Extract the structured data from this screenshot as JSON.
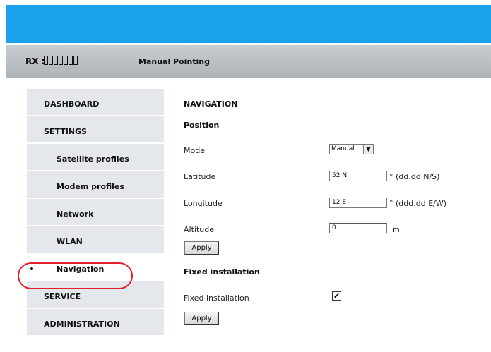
{
  "header": {
    "rx_label": "RX :",
    "page_mode": "Manual Pointing",
    "brand_color": "#1aa2ec"
  },
  "sidebar": {
    "items": [
      {
        "label": "DASHBOARD",
        "level": "top"
      },
      {
        "label": "SETTINGS",
        "level": "top"
      },
      {
        "label": "Satellite profiles",
        "level": "sub"
      },
      {
        "label": "Modem profiles",
        "level": "sub"
      },
      {
        "label": "Network",
        "level": "sub"
      },
      {
        "label": "WLAN",
        "level": "sub"
      },
      {
        "label": "Navigation",
        "level": "sub",
        "active": true
      },
      {
        "label": "SERVICE",
        "level": "top"
      },
      {
        "label": "ADMINISTRATION",
        "level": "top"
      }
    ],
    "highlight_color": "#e0202a"
  },
  "main": {
    "title": "NAVIGATION",
    "position_heading": "Position",
    "mode": {
      "label": "Mode",
      "value": "Manual",
      "arrow_icon": "chevron-down-icon"
    },
    "latitude": {
      "label": "Latitude",
      "value": "52 N",
      "unit": "° (dd.dd N/S)"
    },
    "longitude": {
      "label": "Longitude",
      "value": "12 E",
      "unit": "° (ddd.dd E/W)"
    },
    "altitude": {
      "label": "Altitude",
      "value": "0",
      "unit": "m"
    },
    "apply_label": "Apply",
    "fixed_heading": "Fixed installation",
    "fixed_label": "Fixed installation",
    "fixed_checked": true,
    "fixed_check_glyph": "✔",
    "apply2_label": "Apply"
  }
}
